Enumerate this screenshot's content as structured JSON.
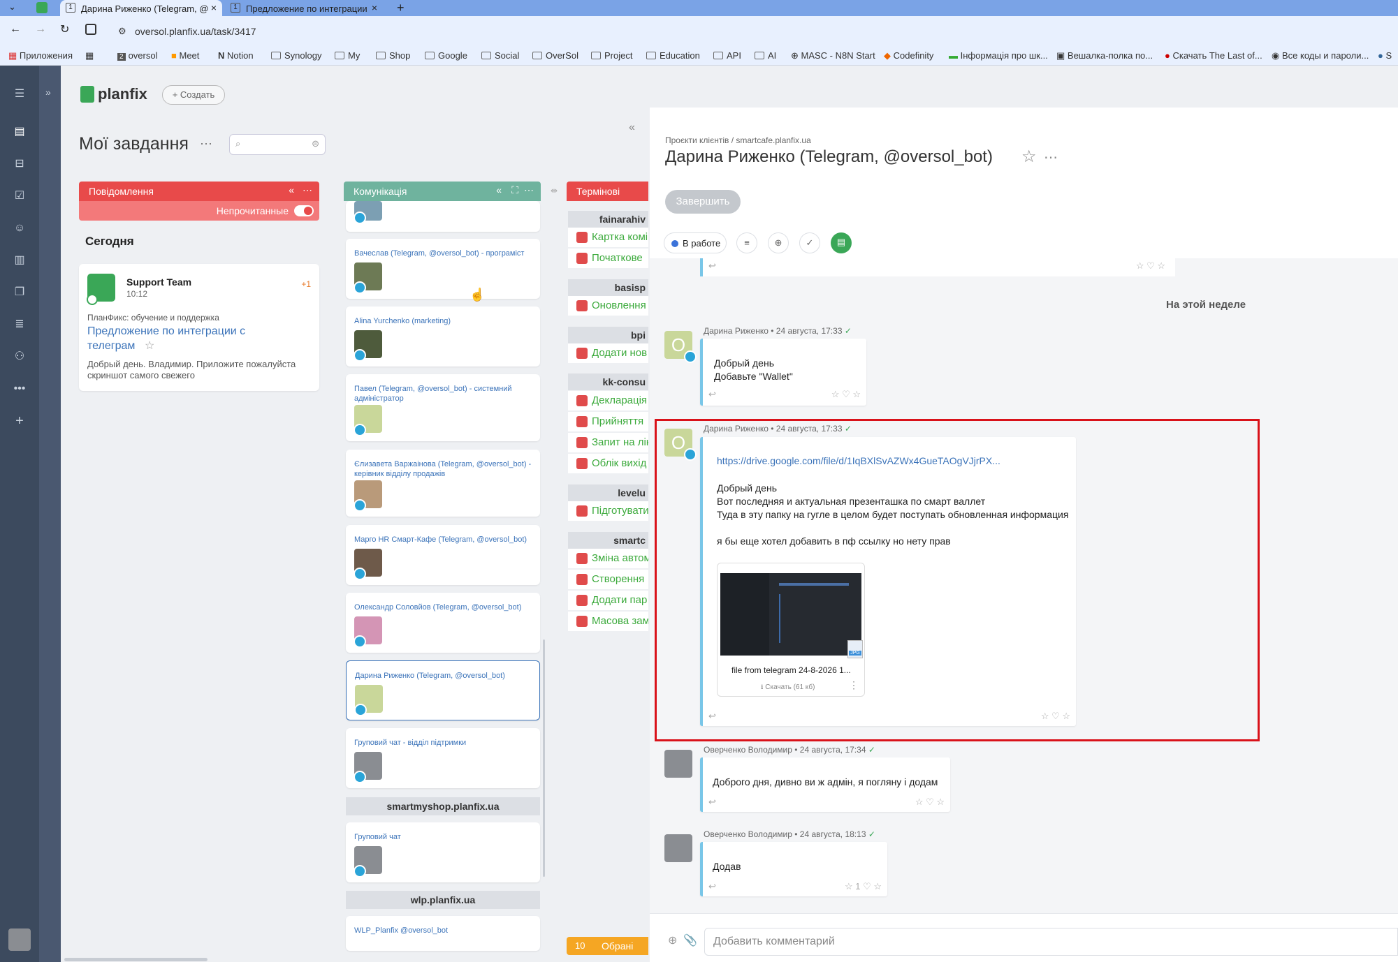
{
  "browser": {
    "tabs": [
      {
        "num": "1",
        "title": "Дарина Риженко (Telegram, @",
        "close": "×"
      },
      {
        "num": "1",
        "title": "Предложение по интеграции",
        "close": "×"
      }
    ],
    "new_tab": "+",
    "url": "oversol.planfix.ua/task/3417",
    "bookmarks": [
      "Приложения",
      "oversol",
      "Meet",
      "Notion",
      "Synology",
      "My",
      "Shop",
      "Google",
      "Social",
      "OverSol",
      "Project",
      "Education",
      "API",
      "AI",
      "MASC - N8N Start",
      "Codefinity",
      "Інформація про шк...",
      "Вешалка-полка по...",
      "Скачать The Last of...",
      "Все коды и пароли...",
      "S"
    ]
  },
  "app": {
    "logo": "planfix",
    "create": "+ Создать",
    "colors": {
      "accent": "#3aa757",
      "red": "#e84a4a",
      "teal": "#6fb39e",
      "link": "#3b73b9",
      "highlight": "#d9121a"
    }
  },
  "board": {
    "title": "Мої завдання",
    "collapse": "«",
    "col1": {
      "title": "Повідомлення",
      "unread_label": "Непрочитанные",
      "section": "Сегодня",
      "card": {
        "sender": "Support Team",
        "time": "10:12",
        "badge": "+1",
        "project": "ПланФикс: обучение и поддержка",
        "task": "Предложение по интеграции с телеграм",
        "preview": "Добрый день. Владимир. Приложите пожалуйста скриншот самого свежего"
      }
    },
    "col2": {
      "title": "Комунікація",
      "cards": [
        "Вачеслав (Telegram, @oversol_bot) - програміст",
        "Alina Yurchenko (marketing)",
        "Павел (Telegram, @oversol_bot) - системний адміністратор",
        "Єлизавета Варжаінова (Telegram, @oversol_bot) - керівник відділу продажів",
        "Марго HR Смарт-Кафе (Telegram, @oversol_bot)",
        "Олександр Соловйов (Telegram, @oversol_bot)",
        "Дарина Риженко (Telegram, @oversol_bot)",
        "Груповий чат - відділ підтримки"
      ],
      "group2": "smartmyshop.planfix.ua",
      "group2_card": "Груповий чат",
      "group3": "wlp.planfix.ua",
      "group3_card": "WLP_Planfix @oversol_bot"
    },
    "col3": {
      "title": "Термінові",
      "groups": [
        {
          "name": "fainarahiv",
          "items": [
            "Картка комі",
            "Початкове"
          ]
        },
        {
          "name": "basisp",
          "items": [
            "Оновлення"
          ]
        },
        {
          "name": "bpi",
          "items": [
            "Додати нов"
          ]
        },
        {
          "name": "kk-consu",
          "items": [
            "Декларація",
            "Прийняття",
            "Запит на лік",
            "Облік вихід"
          ]
        },
        {
          "name": "levelu",
          "items": [
            "Підготувати"
          ]
        },
        {
          "name": "smartc",
          "items": [
            "Зміна автом",
            "Створення",
            "Додати пар",
            "Масова зам"
          ]
        }
      ],
      "footer_count": "10",
      "footer_label": "Обрані"
    }
  },
  "task": {
    "breadcrumb": "Проєкти клієнтів / smartcafe.planfix.ua",
    "title": "Дарина Риженко (Telegram, @oversol_bot)",
    "complete_button": "Завершить",
    "status": "В работе",
    "week_label": "На этой неделе",
    "messages": [
      {
        "author": "Дарина Риженко",
        "date": "24 августа, 17:33",
        "text": "Добрый день\nДобавьте \"Wallet\""
      },
      {
        "author": "Дарина Риженко",
        "date": "24 августа, 17:33",
        "link": "https://drive.google.com/file/d/1IqBXlSvAZWx4GueTAOgVJjrPX...",
        "text": "Добрый день\nВот последняя и актуальная презенташка по смарт валлет\nТуда в эту папку на гугле в целом будет поступать обновленная информация\n\nя бы еще хотел добавить в пф ссылку но нету прав",
        "file_name": "file from telegram 24-8-2026 1...",
        "file_type": "JPG",
        "download": "Скачать",
        "file_size": "(61 кб)"
      },
      {
        "author": "Оверченко Володимир",
        "date": "24 августа, 17:34",
        "text": "Доброго дня, дивно ви ж адмін, я погляну і додам"
      },
      {
        "author": "Оверченко Володимир",
        "date": "24 августа, 18:13",
        "text": "Додав",
        "likes": "1"
      }
    ],
    "comment_placeholder": "Добавить комментарий"
  }
}
